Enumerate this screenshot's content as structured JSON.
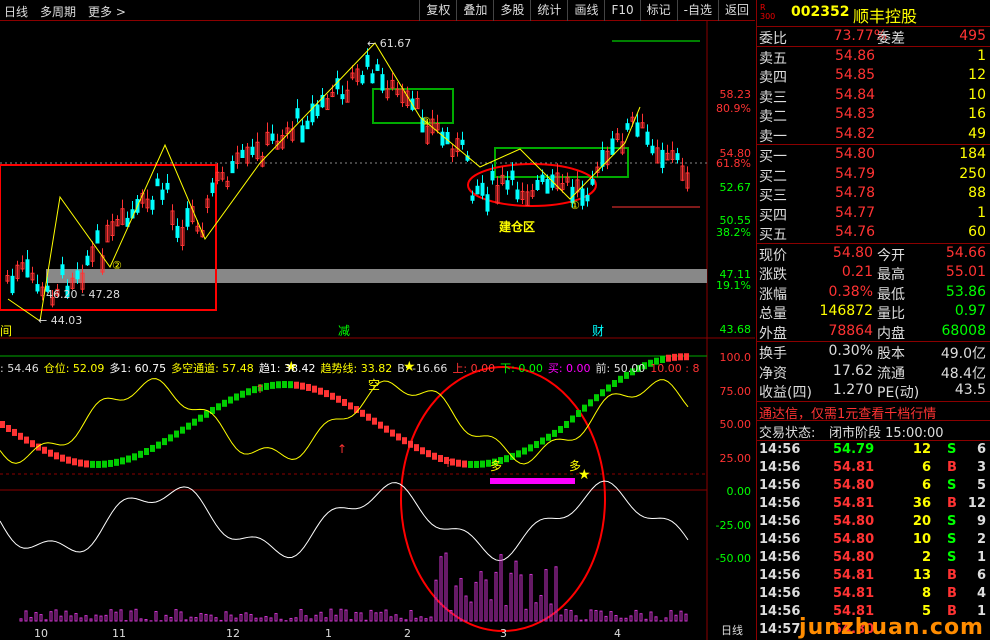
{
  "toolbar": {
    "period": "日线",
    "multi": "多周期",
    "more": "更多",
    "buttons": [
      "复权",
      "叠加",
      "多股",
      "统计",
      "画线",
      "F10",
      "标记",
      "-自选",
      "返回"
    ]
  },
  "price_axis": [
    "58.23",
    "80.9%",
    "54.80",
    "61.8%",
    "52.67",
    "50.55",
    "38.2%",
    "47.11",
    "19.1%",
    "43.68"
  ],
  "annotations": {
    "high": "61.67",
    "range_label": "46.20 - 47.28",
    "low": "44.03",
    "zone": "建仓区",
    "marker_jian": "减",
    "marker_cai": "财",
    "marker_left": "间",
    "circle1": "①",
    "circle2": "②",
    "circle3": "③",
    "duo1": "多",
    "duo2": "多",
    "kong": "空"
  },
  "indicator_bar": [
    {
      "text": ": 54.46",
      "color": "#dddddd"
    },
    {
      "text": "仓位: 52.09",
      "color": "#ffff00"
    },
    {
      "text": "多1: 60.75",
      "color": "#ffffff"
    },
    {
      "text": "多空通道: 57.48",
      "color": "#ffff00"
    },
    {
      "text": "趋1: 38.42",
      "color": "#ffffff"
    },
    {
      "text": "趋势线: 33.82",
      "color": "#ffff00"
    },
    {
      "text": "B: -16.66",
      "color": "#dddddd"
    },
    {
      "text": "上: 0.00",
      "color": "#ff3333"
    },
    {
      "text": "下: 0.00",
      "color": "#00ff00"
    },
    {
      "text": "买: 0.00",
      "color": "#ff00ff"
    },
    {
      "text": "前: 50.00",
      "color": "#dddddd"
    },
    {
      "text": "10.00 : 8",
      "color": "#ff3333"
    }
  ],
  "ind_axis": [
    "100.0",
    "75.00",
    "50.00",
    "25.00",
    "0.00",
    "-25.00",
    "-50.00"
  ],
  "date_axis": [
    "10",
    "11",
    "12",
    "1",
    "2",
    "3",
    "4"
  ],
  "bottom_label": "日线",
  "quote": {
    "rtag": "R\n300",
    "code": "002352",
    "name": "顺丰控股",
    "weibi_label": "委比",
    "weibi": "73.77%",
    "weicha_label": "委差",
    "weicha": "495",
    "asks": [
      {
        "label": "卖五",
        "price": "54.86",
        "vol": "1"
      },
      {
        "label": "卖四",
        "price": "54.85",
        "vol": "12"
      },
      {
        "label": "卖三",
        "price": "54.84",
        "vol": "10"
      },
      {
        "label": "卖二",
        "price": "54.83",
        "vol": "16"
      },
      {
        "label": "卖一",
        "price": "54.82",
        "vol": "49"
      }
    ],
    "bids": [
      {
        "label": "买一",
        "price": "54.80",
        "vol": "184"
      },
      {
        "label": "买二",
        "price": "54.79",
        "vol": "250"
      },
      {
        "label": "买三",
        "price": "54.78",
        "vol": "88"
      },
      {
        "label": "买四",
        "price": "54.77",
        "vol": "1"
      },
      {
        "label": "买五",
        "price": "54.76",
        "vol": "60"
      }
    ],
    "stats": [
      {
        "l1": "现价",
        "v1": "54.80",
        "c1": "#ff3333",
        "l2": "今开",
        "v2": "54.66",
        "c2": "#ff3333"
      },
      {
        "l1": "涨跌",
        "v1": "0.21",
        "c1": "#ff3333",
        "l2": "最高",
        "v2": "55.01",
        "c2": "#ff3333"
      },
      {
        "l1": "涨幅",
        "v1": "0.38%",
        "c1": "#ff3333",
        "l2": "最低",
        "v2": "53.86",
        "c2": "#00ff00"
      },
      {
        "l1": "总量",
        "v1": "146872",
        "c1": "#ffff00",
        "l2": "量比",
        "v2": "0.97",
        "c2": "#00ff00"
      },
      {
        "l1": "外盘",
        "v1": "78864",
        "c1": "#ff3333",
        "l2": "内盘",
        "v2": "68008",
        "c2": "#00ff00"
      }
    ],
    "stats2": [
      {
        "l1": "换手",
        "v1": "0.30%",
        "l2": "股本",
        "v2": "49.0亿"
      },
      {
        "l1": "净资",
        "v1": "17.62",
        "l2": "流通",
        "v2": "48.4亿"
      },
      {
        "l1": "收益(四)",
        "v1": "1.270",
        "l2": "PE(动)",
        "v2": "43.5"
      }
    ],
    "promo": "通达信，仅需1元查看千档行情",
    "status_label": "交易状态:",
    "status": "闭市阶段 15:00:00",
    "ticks": [
      {
        "time": "14:56",
        "price": "54.79",
        "pc": "#00ff00",
        "vol": "12",
        "side": "S",
        "n": "6"
      },
      {
        "time": "14:56",
        "price": "54.81",
        "pc": "#ff3333",
        "vol": "6",
        "side": "B",
        "n": "3"
      },
      {
        "time": "14:56",
        "price": "54.80",
        "pc": "#ff3333",
        "vol": "6",
        "side": "S",
        "n": "5"
      },
      {
        "time": "14:56",
        "price": "54.81",
        "pc": "#ff3333",
        "vol": "36",
        "side": "B",
        "n": "12"
      },
      {
        "time": "14:56",
        "price": "54.80",
        "pc": "#ff3333",
        "vol": "20",
        "side": "S",
        "n": "9"
      },
      {
        "time": "14:56",
        "price": "54.80",
        "pc": "#ff3333",
        "vol": "10",
        "side": "S",
        "n": "2"
      },
      {
        "time": "14:56",
        "price": "54.80",
        "pc": "#ff3333",
        "vol": "2",
        "side": "S",
        "n": "1"
      },
      {
        "time": "14:56",
        "price": "54.81",
        "pc": "#ff3333",
        "vol": "13",
        "side": "B",
        "n": "6"
      },
      {
        "time": "14:56",
        "price": "54.81",
        "pc": "#ff3333",
        "vol": "8",
        "side": "B",
        "n": "4"
      },
      {
        "time": "14:56",
        "price": "54.81",
        "pc": "#ff3333",
        "vol": "5",
        "side": "B",
        "n": "1"
      },
      {
        "time": "14:57",
        "price": "54.80",
        "pc": "#ff3333",
        "vol": "",
        "side": "",
        "n": ""
      }
    ],
    "watermark": "junzhuan.com"
  },
  "colors": {
    "up": "#ff3333",
    "down": "#00ffff",
    "frame": "#8b0000",
    "accent": "#ffff00",
    "green": "#00ff00"
  }
}
